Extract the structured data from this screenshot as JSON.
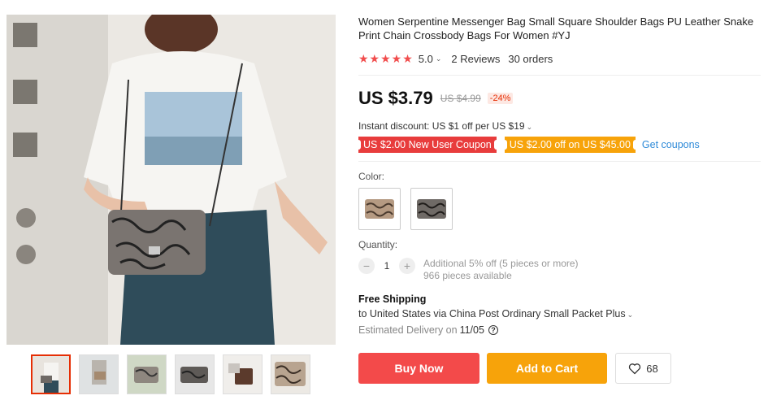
{
  "product": {
    "title": "Women Serpentine Messenger Bag Small Square Shoulder Bags PU Leather Snake Print Chain Crossbody Bags For Women #YJ",
    "rating_stars": "★★★★★",
    "rating_score": "5.0",
    "rating_value": 5.0,
    "reviews": "2 Reviews",
    "orders": "30 orders"
  },
  "price": {
    "current": "US $3.79",
    "original": "US $4.99",
    "discount": "-24%"
  },
  "instant_discount": "Instant discount: US $1 off per US $19",
  "coupons": {
    "new_user": "US $2.00 New User Coupon",
    "store": "US $2.00 off on US $45.00",
    "get_link": "Get coupons"
  },
  "color": {
    "label": "Color:",
    "options": [
      {
        "name": "brown-snake",
        "fill": "#b59a82"
      },
      {
        "name": "grey-snake",
        "fill": "#6f6a66"
      }
    ]
  },
  "quantity": {
    "label": "Quantity:",
    "minus": "−",
    "plus": "+",
    "value": "1",
    "additional": "Additional 5% off (5 pieces or more)",
    "available": "966 pieces available"
  },
  "shipping": {
    "title": "Free Shipping",
    "method": "to United States via China Post Ordinary Small Packet Plus",
    "estimated_label": "Estimated Delivery on",
    "estimated_date": "11/05",
    "help": "?"
  },
  "actions": {
    "buy_now": "Buy Now",
    "add_to_cart": "Add to Cart",
    "wishlist_count": "68"
  },
  "gallery": {
    "main": "woman-with-snake-print-bag",
    "thumbnails": [
      "thumb-1",
      "thumb-2",
      "thumb-3",
      "thumb-4",
      "thumb-5",
      "thumb-6"
    ]
  },
  "colors": {
    "accent_red": "#f34a4a",
    "accent_orange": "#f7a30a",
    "link_blue": "#2e8ad8",
    "star_red": "#f14d4d"
  }
}
